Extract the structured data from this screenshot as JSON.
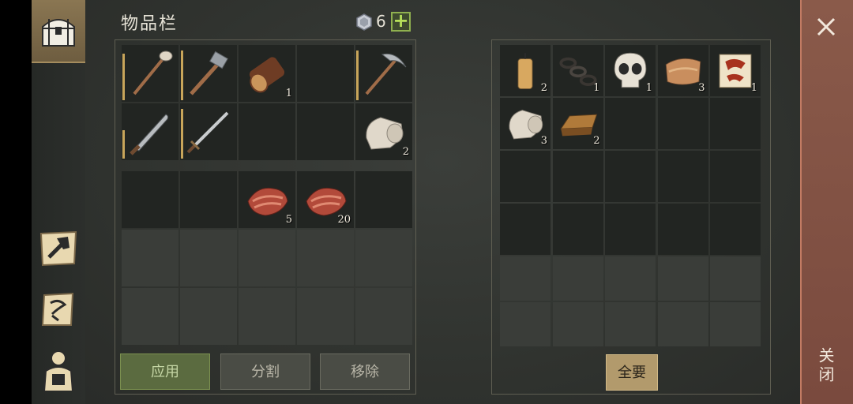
{
  "header": {
    "title": "物品栏",
    "gem_count": "6",
    "plus_label": "+"
  },
  "sidebar": {
    "items": [
      {
        "name": "inventory-chest-icon",
        "active": true
      },
      {
        "name": "craft-hammer-icon",
        "active": false
      },
      {
        "name": "map-scroll-icon",
        "active": false
      },
      {
        "name": "character-backpack-icon",
        "active": false
      }
    ]
  },
  "inventory": {
    "equipment": [
      {
        "item": "shovel-icon",
        "count": ""
      },
      {
        "item": "hammer-icon",
        "count": ""
      },
      {
        "item": "log-icon",
        "count": "1"
      },
      {
        "item": "",
        "count": ""
      },
      {
        "item": "pickaxe-icon",
        "count": ""
      },
      {
        "item": "machete-icon",
        "count": ""
      },
      {
        "item": "sword-icon",
        "count": ""
      },
      {
        "item": "",
        "count": ""
      },
      {
        "item": "",
        "count": ""
      },
      {
        "item": "cloth-roll-icon",
        "count": "2"
      }
    ],
    "backpack": [
      {
        "item": "",
        "count": ""
      },
      {
        "item": "",
        "count": ""
      },
      {
        "item": "raw-meat-icon",
        "count": "5"
      },
      {
        "item": "raw-meat-icon",
        "count": "20"
      },
      {
        "item": "",
        "count": ""
      }
    ]
  },
  "container": {
    "items": [
      {
        "item": "candle-icon",
        "count": "2"
      },
      {
        "item": "chain-icon",
        "count": "1"
      },
      {
        "item": "skull-icon",
        "count": "1"
      },
      {
        "item": "leather-icon",
        "count": "3"
      },
      {
        "item": "scroll-icon",
        "count": "1"
      },
      {
        "item": "cloth-roll-icon",
        "count": "3"
      },
      {
        "item": "bronze-ingot-icon",
        "count": "2"
      }
    ]
  },
  "buttons": {
    "apply": "应用",
    "split": "分割",
    "remove": "移除",
    "take_all": "全要"
  },
  "close": {
    "label": "关闭"
  },
  "colors": {
    "accent_green": "#8fb04f",
    "close_bar": "#8a5a4a",
    "take_all": "#b29a6c"
  }
}
